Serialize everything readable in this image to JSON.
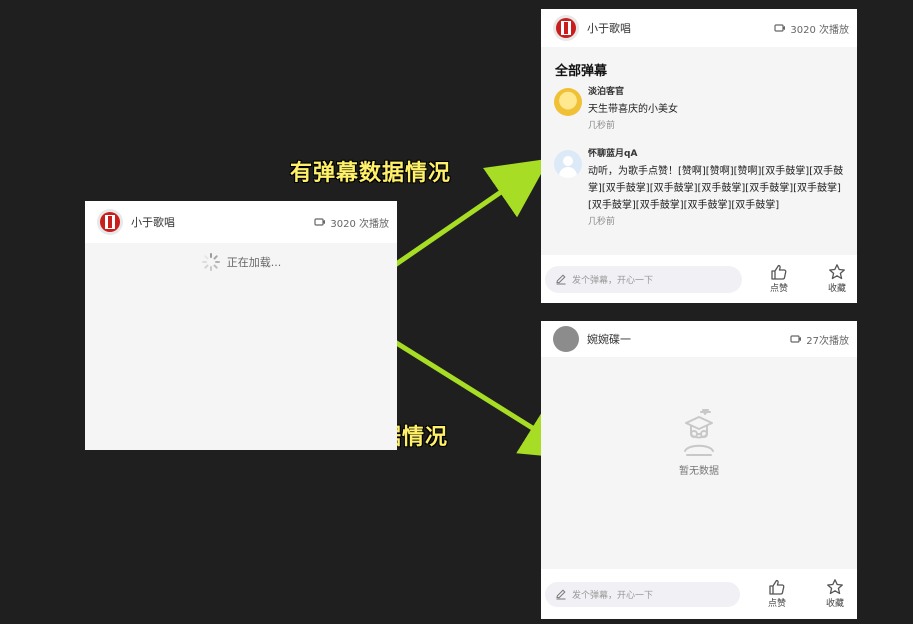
{
  "annotations": {
    "with_data": "有弹幕数据情况",
    "without_data": "无弹幕数据情况"
  },
  "loading_panel": {
    "user_name": "小于歌唱",
    "play_count": "3020 次播放",
    "loading_text": "正在加载..."
  },
  "danmu_panel": {
    "user_name": "小于歌唱",
    "play_count": "3020 次播放",
    "section_title": "全部弹幕",
    "comments": [
      {
        "user": "淡泊客官",
        "text": "天生带喜庆的小美女",
        "time": "几秒前"
      },
      {
        "user": "怀聊蓝月qA",
        "text": "动听，为歌手点赞！[赞啊][赞啊][赞啊][双手鼓掌][双手鼓掌][双手鼓掌][双手鼓掌][双手鼓掌][双手鼓掌][双手鼓掌][双手鼓掌][双手鼓掌][双手鼓掌][双手鼓掌]",
        "time": "几秒前"
      }
    ],
    "input_placeholder": "发个弹幕，开心一下",
    "like_label": "点赞",
    "favorite_label": "收藏"
  },
  "empty_panel": {
    "user_name": "婉婉碟一",
    "play_count": "27次播放",
    "empty_text": "暂无数据",
    "input_placeholder": "发个弹幕，开心一下",
    "like_label": "点赞",
    "favorite_label": "收藏"
  },
  "colors": {
    "background": "#1f1f1f",
    "arrow": "#a7dd24",
    "annotation": "#fff06a",
    "panel": "#f5f5f5",
    "brand_red": "#c91e1e"
  },
  "icons": {
    "play": "video-count-icon",
    "loading": "loading-spinner-icon",
    "pen": "edit-pen-icon",
    "like": "thumbs-up-icon",
    "favorite": "star-icon",
    "empty": "empty-state-icon"
  }
}
